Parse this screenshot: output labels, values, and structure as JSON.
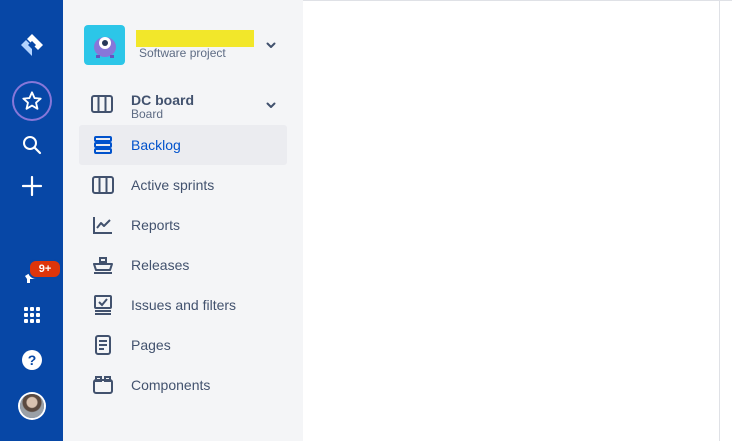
{
  "global_nav": {
    "icons": [
      "jira-logo-icon",
      "star-icon",
      "search-icon",
      "plus-icon",
      "megaphone-icon",
      "app-switcher-icon",
      "help-icon",
      "avatar"
    ],
    "notification_badge": "9+"
  },
  "project": {
    "name": "",
    "type": "Software project"
  },
  "board": {
    "title": "DC board",
    "subtitle": "Board"
  },
  "sidebar": {
    "items": [
      {
        "label": "Backlog",
        "icon": "backlog-icon",
        "selected": true
      },
      {
        "label": "Active sprints",
        "icon": "active-sprints-icon",
        "selected": false
      },
      {
        "label": "Reports",
        "icon": "reports-icon",
        "selected": false
      },
      {
        "label": "Releases",
        "icon": "releases-icon",
        "selected": false
      },
      {
        "label": "Issues and filters",
        "icon": "issues-icon",
        "selected": false
      },
      {
        "label": "Pages",
        "icon": "pages-icon",
        "selected": false
      },
      {
        "label": "Components",
        "icon": "components-icon",
        "selected": false
      }
    ]
  },
  "colors": {
    "global_nav_bg": "#0747a6",
    "sidebar_bg": "#f4f5f7",
    "selected_bg": "#ebecf0",
    "selected_text": "#0052cc",
    "badge_bg": "#de350b",
    "project_avatar_bg": "#2cc6e8"
  }
}
